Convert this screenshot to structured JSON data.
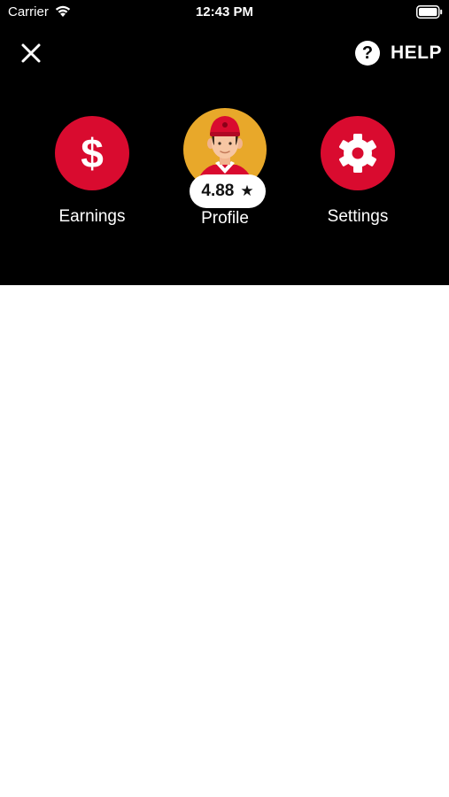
{
  "status_bar": {
    "carrier": "Carrier",
    "time": "12:43 PM",
    "wifi_icon": "wifi-icon",
    "battery_icon": "battery-icon"
  },
  "top_bar": {
    "close_icon": "close-icon",
    "help_icon": "question-circle-icon",
    "help_label": "HELP"
  },
  "menu": {
    "earnings": {
      "label": "Earnings",
      "icon": "dollar-icon",
      "icon_glyph": "$"
    },
    "profile": {
      "label": "Profile",
      "rating": "4.88",
      "rating_icon": "star-icon",
      "star_glyph": "★"
    },
    "settings": {
      "label": "Settings",
      "icon": "gear-icon"
    }
  },
  "colors": {
    "header_bg": "#000000",
    "accent_red": "#d90b2f",
    "avatar_bg": "#e8a82a",
    "body_bg": "#ffffff"
  }
}
